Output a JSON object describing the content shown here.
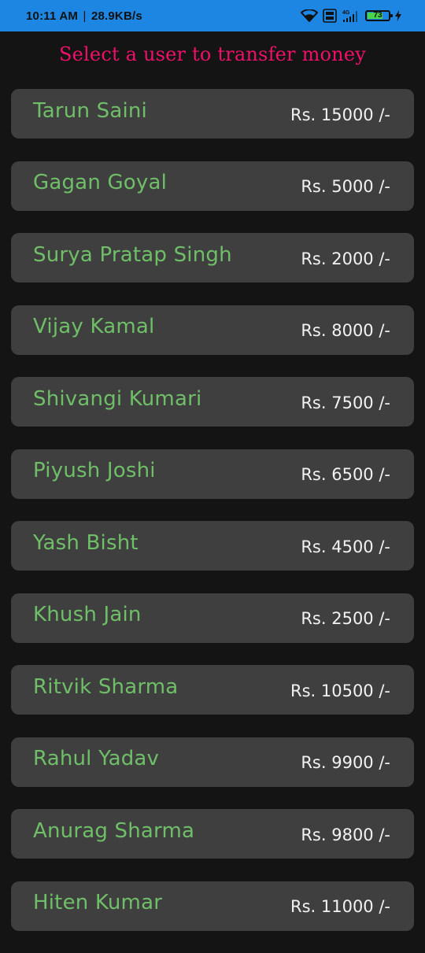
{
  "status_bar": {
    "time": "10:11 AM",
    "separator": "|",
    "speed": "28.9KB/s",
    "volte": "Vo LTE",
    "network": "4G",
    "battery": "73",
    "battery_level": 0.73
  },
  "title": "Select a user to transfer money",
  "users": [
    {
      "name": "Tarun Saini",
      "balance": "Rs. 15000 /-"
    },
    {
      "name": "Gagan Goyal",
      "balance": "Rs. 5000 /-"
    },
    {
      "name": "Surya Pratap Singh",
      "balance": "Rs. 2000 /-"
    },
    {
      "name": "Vijay Kamal",
      "balance": "Rs. 8000 /-"
    },
    {
      "name": "Shivangi Kumari",
      "balance": "Rs. 7500 /-"
    },
    {
      "name": "Piyush Joshi",
      "balance": "Rs. 6500 /-"
    },
    {
      "name": "Yash Bisht",
      "balance": "Rs. 4500 /-"
    },
    {
      "name": "Khush Jain",
      "balance": "Rs. 2500 /-"
    },
    {
      "name": "Ritvik Sharma",
      "balance": "Rs. 10500 /-"
    },
    {
      "name": "Rahul Yadav",
      "balance": "Rs. 9900 /-"
    },
    {
      "name": "Anurag Sharma",
      "balance": "Rs. 9800 /-"
    },
    {
      "name": "Hiten Kumar",
      "balance": "Rs. 11000 /-"
    }
  ],
  "colors": {
    "status_bar": "#1d86e2",
    "background": "#141414",
    "title": "#f0106a",
    "card": "#3f3f3f",
    "name": "#6fbf68",
    "balance": "#f2f2f2"
  }
}
